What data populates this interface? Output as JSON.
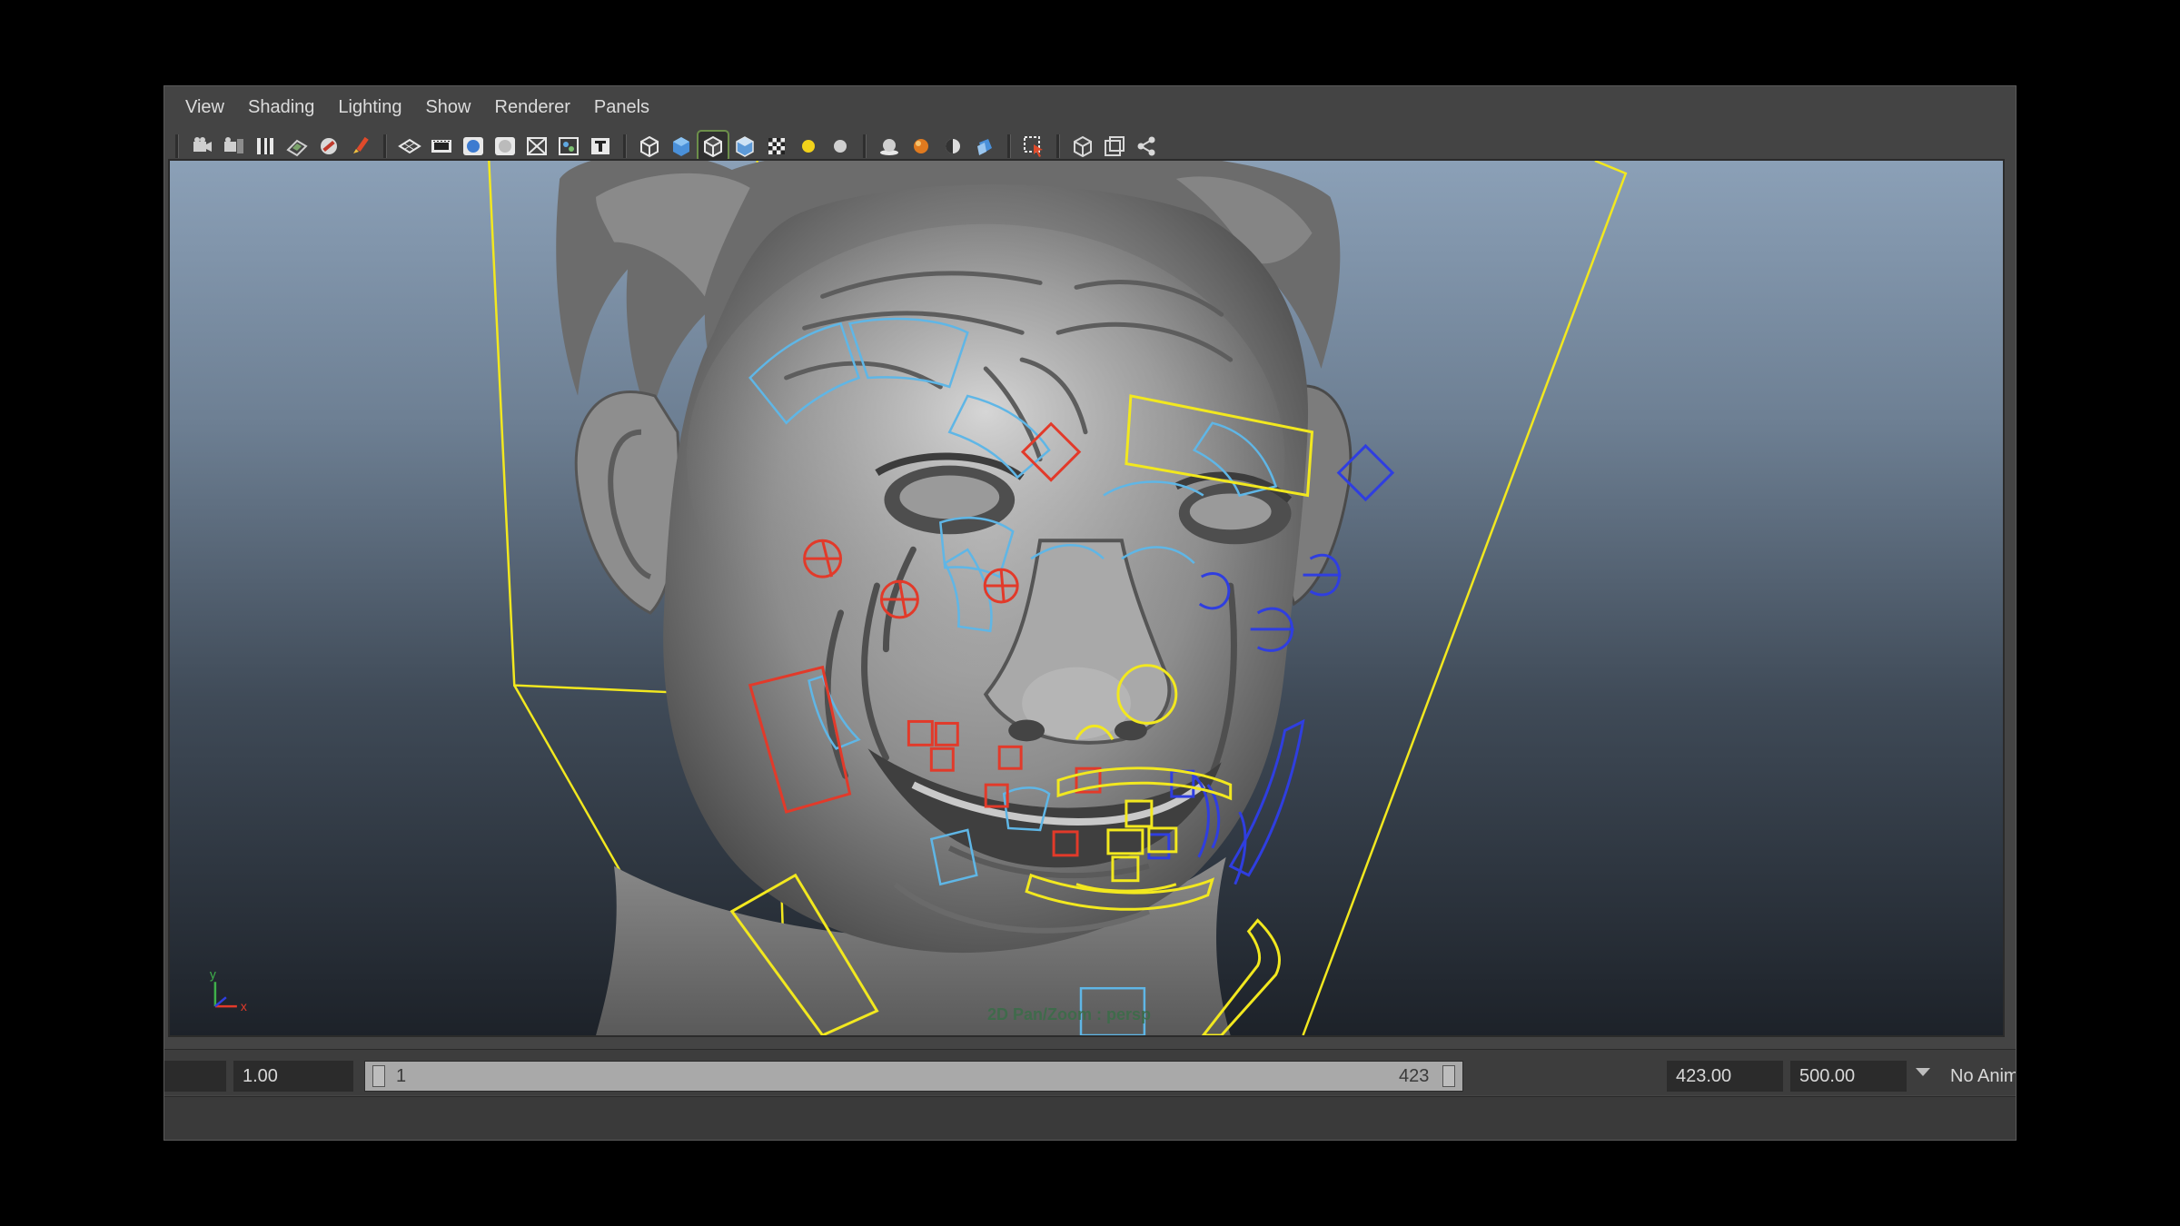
{
  "menu": {
    "items": [
      "View",
      "Shading",
      "Lighting",
      "Show",
      "Renderer",
      "Panels"
    ]
  },
  "toolbar": {
    "icons": [
      "camera-icon",
      "camera-attributes-icon",
      "bookmark-icon",
      "image-plane-icon",
      "grease-pencil-icon",
      "paint-icon",
      "grid-icon",
      "film-gate-icon",
      "resolution-gate-icon",
      "gate-mask-icon",
      "field-chart-icon",
      "safe-action-icon",
      "safe-title-icon",
      "wireframe-icon",
      "smooth-shade-icon",
      "wireframe-on-shaded-icon",
      "default-material-icon",
      "textured-icon",
      "use-all-lights-icon",
      "default-light-icon",
      "shadows-icon",
      "screen-space-ao-icon",
      "motion-blur-icon",
      "multisample-aa-icon",
      "isolate-select-icon",
      "xray-icon",
      "xray-joints-icon",
      "xray-components-icon"
    ]
  },
  "viewport": {
    "hud_label": "2D Pan/Zoom : persp",
    "axis_labels": {
      "y": "y",
      "x": "x"
    }
  },
  "timeline": {
    "current_frame": "1.00",
    "range_start_inner": "1",
    "range_end_inner": "423",
    "range_end": "423.00",
    "anim_end": "500.00",
    "anim_layer": "No Anim"
  },
  "colors": {
    "rig_yellow": "#f2e81f",
    "rig_red": "#e23a2a",
    "rig_blue": "#2f3ee0",
    "rig_cyan": "#5fb6e6"
  }
}
